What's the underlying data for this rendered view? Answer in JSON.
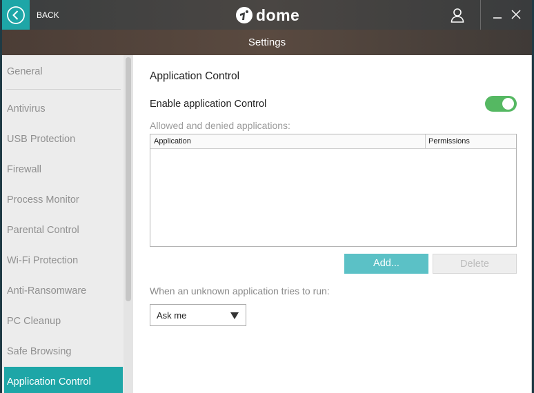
{
  "titlebar": {
    "back_label": "BACK",
    "brand": "dome",
    "icons": [
      "back-arrow-icon",
      "dome-logo-icon",
      "user-icon",
      "minimize-icon",
      "close-icon"
    ]
  },
  "header": {
    "title": "Settings"
  },
  "sidebar": {
    "items": [
      {
        "label": "General"
      },
      {
        "label": "Antivirus"
      },
      {
        "label": "USB Protection"
      },
      {
        "label": "Firewall"
      },
      {
        "label": "Process Monitor"
      },
      {
        "label": "Parental Control"
      },
      {
        "label": "Wi-Fi Protection"
      },
      {
        "label": "Anti-Ransomware"
      },
      {
        "label": "PC Cleanup"
      },
      {
        "label": "Safe Browsing"
      },
      {
        "label": "Application Control"
      }
    ],
    "active": "Application Control"
  },
  "main": {
    "title": "Application Control",
    "enable_label": "Enable application Control",
    "enabled": true,
    "list_caption": "Allowed and denied applications:",
    "table": {
      "columns": [
        "Application",
        "Permissions"
      ],
      "rows": []
    },
    "add_label": "Add...",
    "delete_label": "Delete",
    "unknown_caption": "When an unknown application tries to run:",
    "unknown_action": "Ask me"
  },
  "colors": {
    "accent": "#1ea6a7",
    "toggle_on": "#55b862",
    "add_button": "#5bc1c6"
  }
}
